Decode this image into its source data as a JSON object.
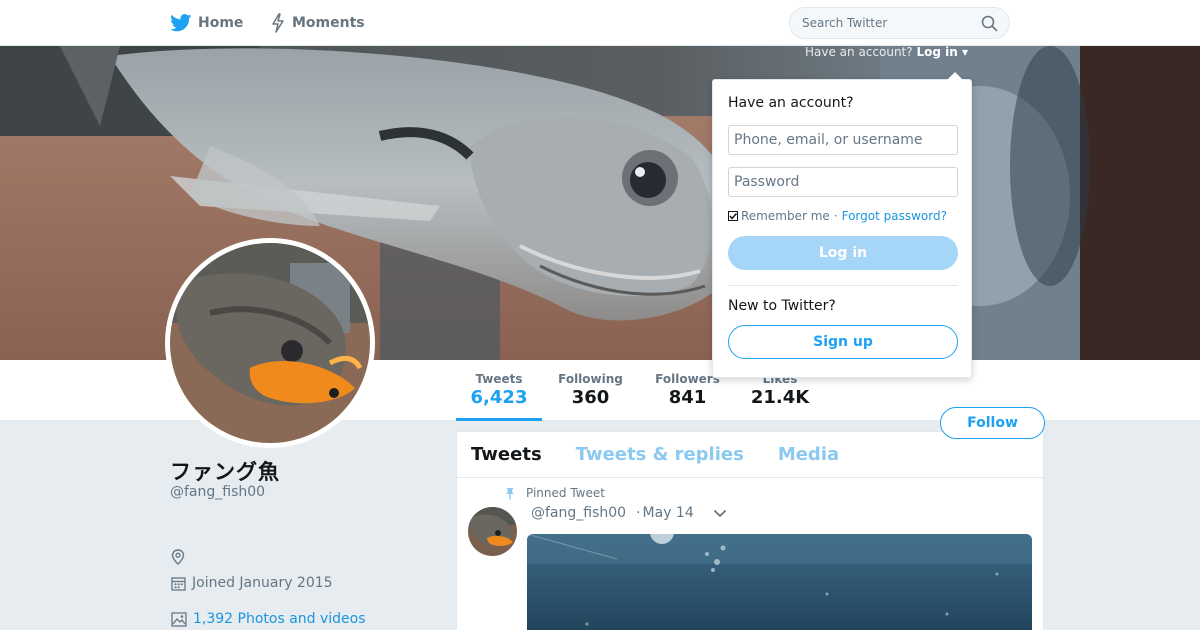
{
  "nav": {
    "home_label": "Home",
    "moments_label": "Moments",
    "home_icon": "twitter-bird-icon",
    "moments_icon": "lightning-bolt-icon"
  },
  "search": {
    "placeholder": "Search Twitter",
    "icon": "search-icon"
  },
  "login_hint": {
    "text": "Have an account?",
    "link": "Log in"
  },
  "login_dropdown": {
    "title": "Have an account?",
    "username_placeholder": "Phone, email, or username",
    "password_placeholder": "Password",
    "remember_label": "Remember me",
    "separator": "·",
    "forgot_label": "Forgot password?",
    "login_button": "Log in",
    "new_prompt": "New to Twitter?",
    "signup_button": "Sign up"
  },
  "profile": {
    "name": "ファング魚",
    "handle": "@fang_fish00",
    "joined": "Joined January 2015",
    "photos": "1,392 Photos and videos",
    "location_icon": "location-pin-icon",
    "calendar_icon": "calendar-icon",
    "photos_icon": "image-icon"
  },
  "stats": [
    {
      "label": "Tweets",
      "value": "6,423"
    },
    {
      "label": "Following",
      "value": "360"
    },
    {
      "label": "Followers",
      "value": "841"
    },
    {
      "label": "Likes",
      "value": "21.4K"
    }
  ],
  "follow_button": "Follow",
  "timeline": {
    "tabs": [
      "Tweets",
      "Tweets & replies",
      "Media"
    ],
    "pinned_label": "Pinned Tweet",
    "tweet": {
      "handle": "@fang_fish00",
      "dot": "·",
      "date": "May 14"
    }
  },
  "colors": {
    "accent": "#1da1f2",
    "background": "#e6ecf0",
    "text_secondary": "#657786",
    "link": "#1b95e0"
  }
}
